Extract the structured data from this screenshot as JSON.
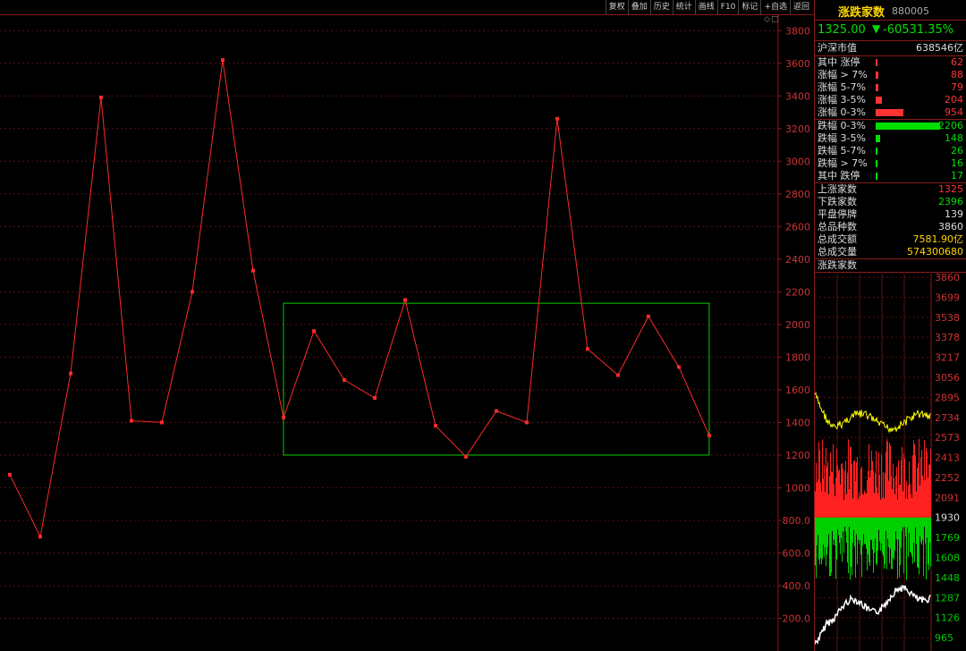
{
  "toolbar": {
    "buttons": [
      "复权",
      "叠加",
      "历史",
      "统计",
      "画线",
      "F10",
      "标记",
      "+自选",
      "返回"
    ]
  },
  "panel": {
    "title": "涨跌家数",
    "code": "880005",
    "price": "1325.00",
    "change": "-60531.35%",
    "market_cap_label": "沪深市值",
    "market_cap_value": "638546亿",
    "rise_rows": [
      {
        "label": "其中 涨停",
        "value": "62"
      },
      {
        "label": "涨幅 > 7%",
        "value": "88"
      },
      {
        "label": "涨幅 5-7%",
        "value": "79"
      },
      {
        "label": "涨幅 3-5%",
        "value": "204"
      },
      {
        "label": "涨幅 0-3%",
        "value": "954"
      }
    ],
    "fall_rows": [
      {
        "label": "跌幅 0-3%",
        "value": "2206"
      },
      {
        "label": "跌幅 3-5%",
        "value": "148"
      },
      {
        "label": "跌幅 5-7%",
        "value": "26"
      },
      {
        "label": "跌幅 > 7%",
        "value": "16"
      },
      {
        "label": "其中 跌停",
        "value": "17"
      }
    ],
    "summary_rows": [
      {
        "label": "上涨家数",
        "value": "1325"
      },
      {
        "label": "下跌家数",
        "value": "2396"
      },
      {
        "label": "平盘停牌",
        "value": "139"
      },
      {
        "label": "总品种数",
        "value": "3860"
      },
      {
        "label": "总成交额",
        "value": "7581.90亿"
      },
      {
        "label": "总成交量",
        "value": "574300680"
      }
    ],
    "mini_title": "涨跌家数",
    "mini_ticks": [
      "3860",
      "3699",
      "3538",
      "3378",
      "3217",
      "3056",
      "2895",
      "2734",
      "2573",
      "2413",
      "2252",
      "2091",
      "1930",
      "1769",
      "1608",
      "1448",
      "1287",
      "1126",
      "965"
    ]
  },
  "colors": {
    "up": "#ff3333",
    "down": "#00e000",
    "line": "#ff2a2a",
    "box": "#00cc00"
  },
  "chart_data": {
    "type": "line",
    "ylim": [
      0,
      3900
    ],
    "yticks": [
      "200.0",
      "400.0",
      "600.0",
      "800.0",
      "1000",
      "1200",
      "1400",
      "1600",
      "1800",
      "2000",
      "2200",
      "2400",
      "2600",
      "2800",
      "3000",
      "3200",
      "3400",
      "3600",
      "3800"
    ],
    "values": [
      1080,
      700,
      1700,
      3390,
      1410,
      1400,
      2200,
      3620,
      2330,
      1430,
      1960,
      1660,
      1550,
      2150,
      1380,
      1190,
      1470,
      1400,
      3260,
      1850,
      1690,
      2050,
      1740,
      1320
    ],
    "box": {
      "from_index": 9,
      "to_index": 23,
      "ymin": 1200,
      "ymax": 2130
    }
  }
}
